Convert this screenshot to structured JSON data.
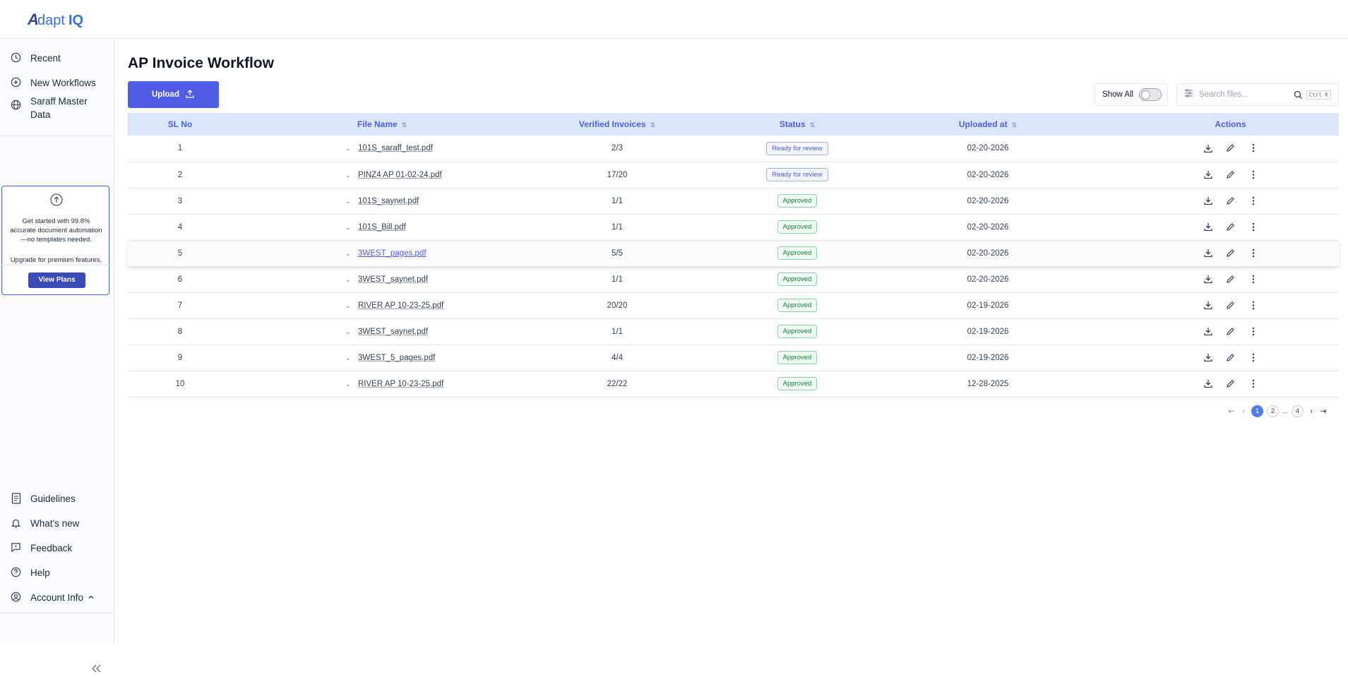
{
  "app": {
    "logo_text": "AdaptIQ"
  },
  "sidebar": {
    "items": [
      {
        "label": "Recent",
        "icon": "clock-icon"
      },
      {
        "label": "New Workflows",
        "icon": "plus-circle-icon"
      },
      {
        "label": "Saraff Master Data",
        "icon": "globe-icon"
      }
    ],
    "promo": {
      "text": "Get started with 99.8% accurate document automation—no templates needed.",
      "upgrade": "Upgrade for premium features.",
      "button": "View Plans"
    },
    "bottom_items": [
      {
        "label": "Guidelines",
        "icon": "book-icon"
      },
      {
        "label": "What's new",
        "icon": "bell-icon"
      },
      {
        "label": "Feedback",
        "icon": "feedback-icon"
      },
      {
        "label": "Help",
        "icon": "help-icon"
      },
      {
        "label": "Account Info",
        "icon": "user-circle-icon"
      }
    ]
  },
  "main": {
    "title": "AP Invoice Workflow",
    "upload_label": "Upload",
    "show_all_label": "Show All",
    "search": {
      "placeholder": "Search files...",
      "shortcut": "Ctrl K"
    },
    "columns": [
      "SL No",
      "File Name",
      "Verified Invoices",
      "Status",
      "Uploaded at",
      "Actions"
    ],
    "rows": [
      {
        "sl": "1",
        "file": "101S_saraff_test.pdf",
        "verified": "2/3",
        "status": "Ready for review",
        "uploaded": "02-20-2026"
      },
      {
        "sl": "2",
        "file": "PINZ4 AP 01-02-24.pdf",
        "verified": "17/20",
        "status": "Ready for review",
        "uploaded": "02-20-2026"
      },
      {
        "sl": "3",
        "file": "101S_saynet.pdf",
        "verified": "1/1",
        "status": "Approved",
        "uploaded": "02-20-2026"
      },
      {
        "sl": "4",
        "file": "101S_Bill.pdf",
        "verified": "1/1",
        "status": "Approved",
        "uploaded": "02-20-2026"
      },
      {
        "sl": "5",
        "file": "3WEST_pages.pdf",
        "verified": "5/5",
        "status": "Approved",
        "uploaded": "02-20-2026"
      },
      {
        "sl": "6",
        "file": "3WEST_saynet.pdf",
        "verified": "1/1",
        "status": "Approved",
        "uploaded": "02-20-2026"
      },
      {
        "sl": "7",
        "file": "RIVER AP 10-23-25.pdf",
        "verified": "20/20",
        "status": "Approved",
        "uploaded": "02-19-2026"
      },
      {
        "sl": "8",
        "file": "3WEST_saynet.pdf",
        "verified": "1/1",
        "status": "Approved",
        "uploaded": "02-19-2026"
      },
      {
        "sl": "9",
        "file": "3WEST_5_pages.pdf",
        "verified": "4/4",
        "status": "Approved",
        "uploaded": "02-19-2026"
      },
      {
        "sl": "10",
        "file": "RIVER AP 10-23-25.pdf",
        "verified": "22/22",
        "status": "Approved",
        "uploaded": "12-28-2025"
      }
    ],
    "pagination": {
      "pages": [
        "1",
        "2",
        "...",
        "4"
      ],
      "current": "1"
    }
  },
  "colors": {
    "accent": "#4f5ce6",
    "header_bg": "#dbe6fb",
    "approved": "#15803d"
  }
}
